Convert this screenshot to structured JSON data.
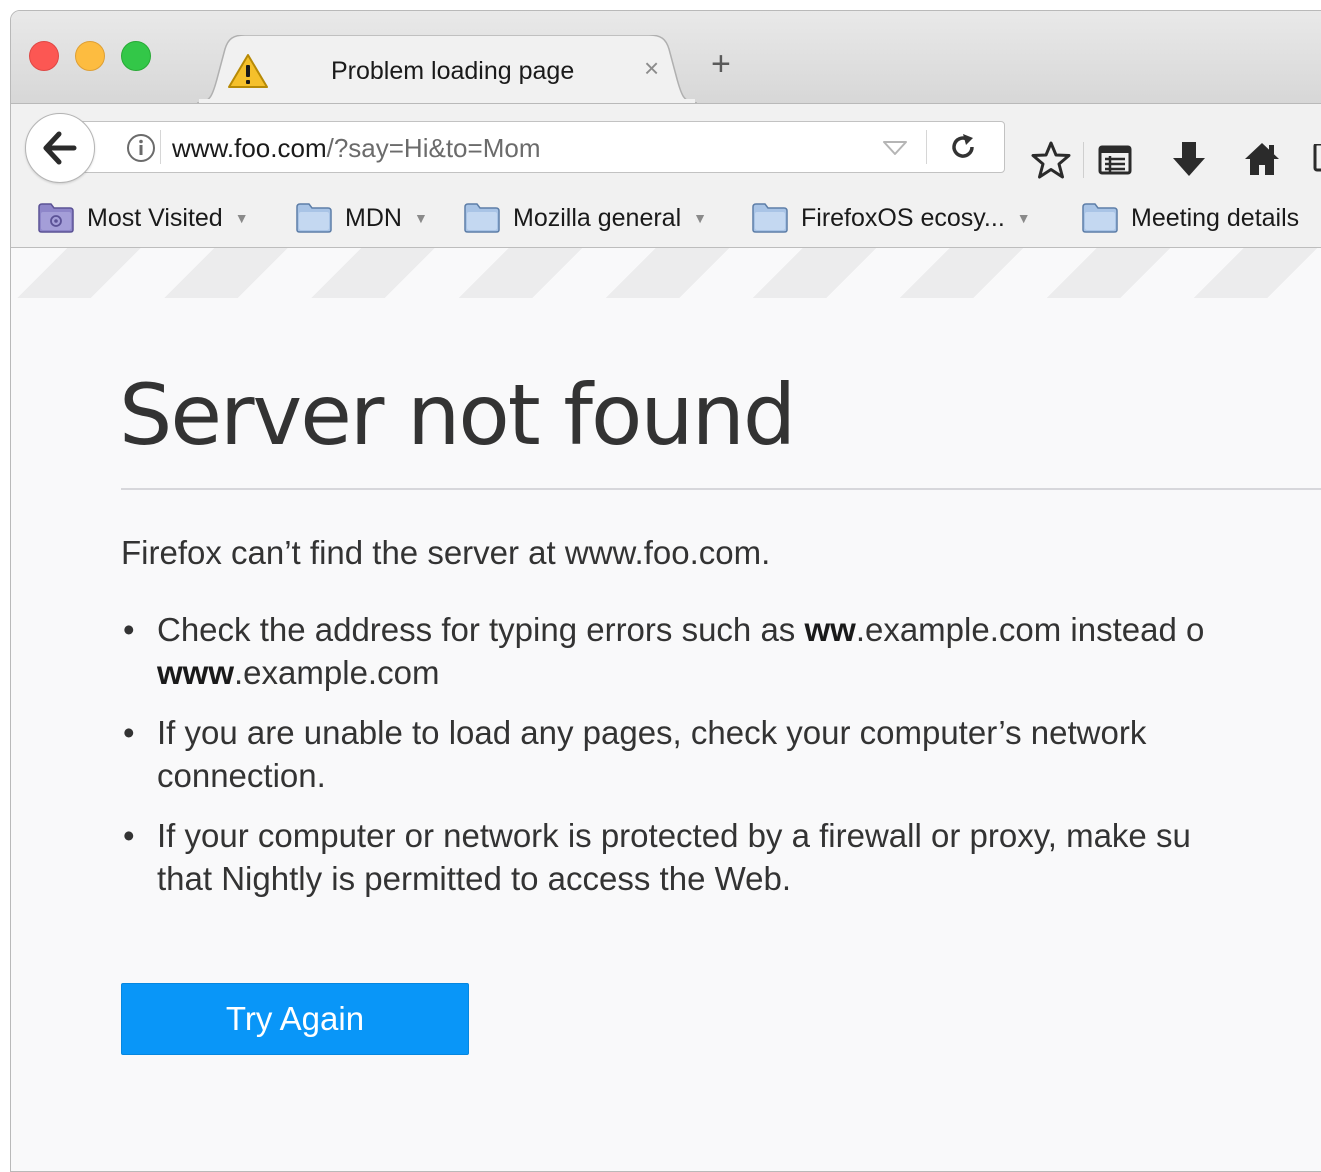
{
  "window": {
    "controls": [
      "close",
      "minimize",
      "maximize"
    ]
  },
  "tab": {
    "icon": "warning-icon",
    "title": "Problem loading page",
    "close_label": "×",
    "new_tab_label": "+"
  },
  "navbar": {
    "back_icon": "back-arrow-icon",
    "url": {
      "host": "www.foo.com",
      "path": "/?say=Hi&to=Mom"
    },
    "icons": [
      "info-icon",
      "dropdown-icon",
      "reload-icon",
      "bookmark-star-icon",
      "reader-list-icon",
      "download-icon",
      "home-icon"
    ]
  },
  "bookmarks": [
    {
      "label": "Most Visited",
      "icon": "smart-folder-icon",
      "has_menu": true
    },
    {
      "label": "MDN",
      "icon": "folder-icon",
      "has_menu": true
    },
    {
      "label": "Mozilla general",
      "icon": "folder-icon",
      "has_menu": true
    },
    {
      "label": "FirefoxOS ecosy...",
      "icon": "folder-icon",
      "has_menu": true
    },
    {
      "label": "Meeting details",
      "icon": "folder-icon",
      "has_menu": false
    }
  ],
  "error": {
    "title": "Server not found",
    "description": "Firefox can’t find the server at www.foo.com.",
    "tips": {
      "tip1": {
        "pre": "Check the address for typing errors such as ",
        "bold1": "ww",
        "mid": ".example.com instead o",
        "bold2": "www",
        "post": ".example.com"
      },
      "tip2": {
        "line1": "If you are unable to load any pages, check your computer’s network",
        "line2": "connection."
      },
      "tip3": {
        "line1": "If your computer or network is protected by a firewall or proxy, make su",
        "line2": "that Nightly is permitted to access the Web."
      }
    },
    "button_label": "Try Again"
  },
  "colors": {
    "accent": "#0996f8",
    "close": "#fc5753",
    "minimize": "#fdbc40",
    "maximize": "#33c748"
  }
}
